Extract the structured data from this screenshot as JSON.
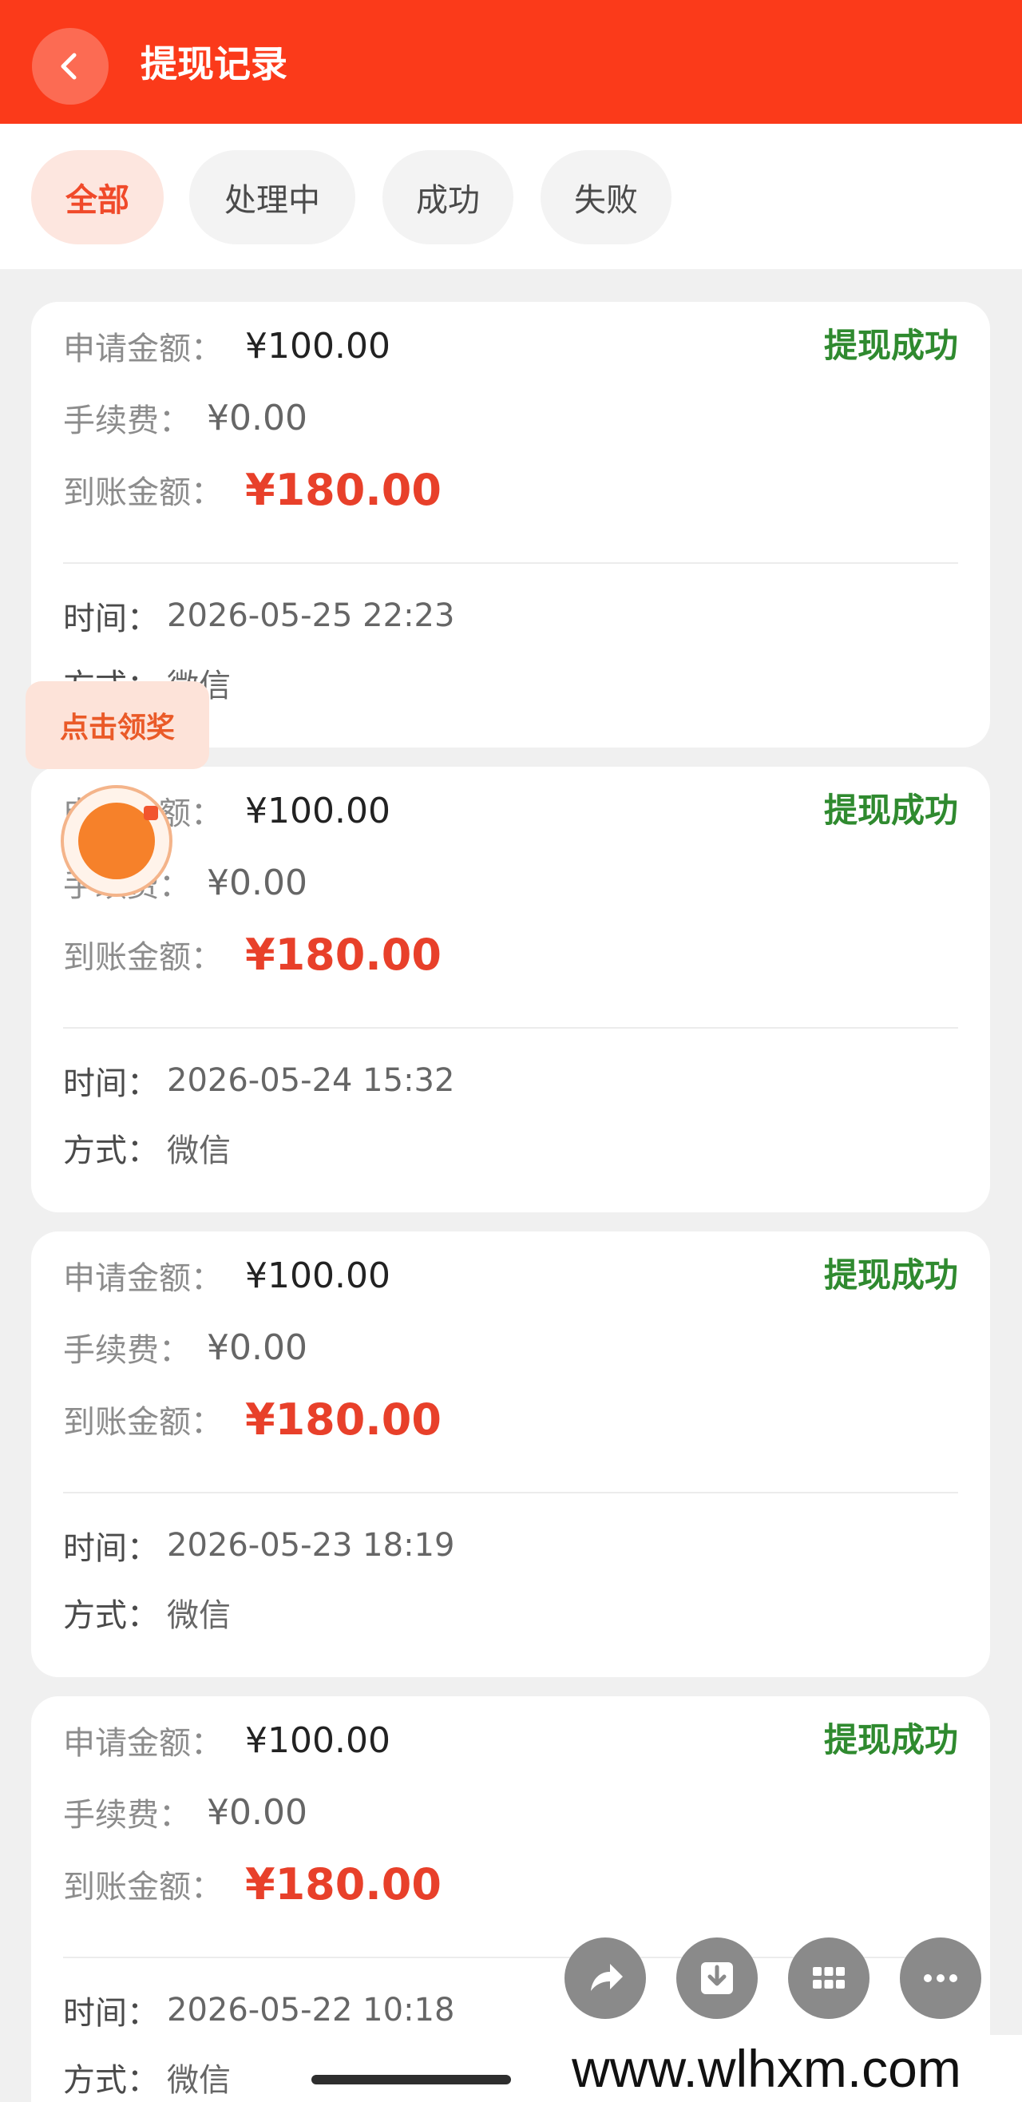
{
  "header": {
    "title": "提现记录",
    "back_icon": "chevron-left-icon",
    "background": "#fb3a1a"
  },
  "tabs": [
    {
      "label": "全部",
      "active": true
    },
    {
      "label": "处理中",
      "active": false
    },
    {
      "label": "成功",
      "active": false
    },
    {
      "label": "失败",
      "active": false
    }
  ],
  "labels": {
    "apply_amount": "申请金额：",
    "fee": "手续费：",
    "received_amount": "到账金额：",
    "time": "时间：",
    "method": "方式："
  },
  "records": [
    {
      "apply_amount": "¥100.00",
      "fee": "¥0.00",
      "received_amount": "¥180.00",
      "status": "提现成功",
      "time": "2026-05-25 22:23",
      "method": "微信"
    },
    {
      "apply_amount": "¥100.00",
      "fee": "¥0.00",
      "received_amount": "¥180.00",
      "status": "提现成功",
      "time": "2026-05-24 15:32",
      "method": "微信"
    },
    {
      "apply_amount": "¥100.00",
      "fee": "¥0.00",
      "received_amount": "¥180.00",
      "status": "提现成功",
      "time": "2026-05-23 18:19",
      "method": "微信"
    },
    {
      "apply_amount": "¥100.00",
      "fee": "¥0.00",
      "received_amount": "¥180.00",
      "status": "提现成功",
      "time": "2026-05-22 10:18",
      "method": "微信"
    }
  ],
  "reward_widget": {
    "label": "点击领奖"
  },
  "action_bar": [
    "share-icon",
    "download-icon",
    "grid-icon",
    "more-icon"
  ],
  "watermark": "www.wlhxm.com",
  "colors": {
    "status_success": "#2f8a2f",
    "amount": "#e8402a",
    "tab_active_bg": "#fde6df"
  }
}
